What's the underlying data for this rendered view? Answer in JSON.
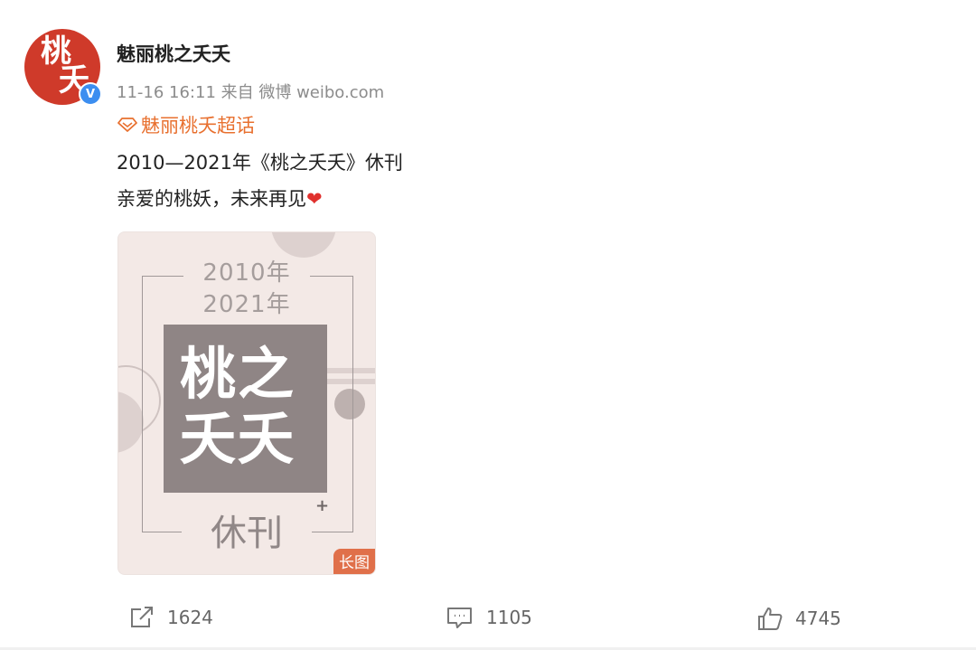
{
  "avatar": {
    "glyph_top": "桃",
    "glyph_bottom": "夭",
    "verified_mark": "V",
    "bg_color": "#cf3a2a",
    "badge_color": "#3c8ef0"
  },
  "post": {
    "username": "魅丽桃之夭夭",
    "meta": "11-16 16:11  来自 微博 weibo.com",
    "topic": "魅丽桃夭超话",
    "topic_icon": "diamond-icon",
    "line1": "2010—2021年《桃之夭夭》休刊",
    "line2": "亲爱的桃妖，未来再见",
    "heart": "❤"
  },
  "image": {
    "year_start": "2010年",
    "year_end": "2021年",
    "title_line1": "桃之",
    "title_line2": "夭夭",
    "subtitle": "休刊",
    "plus": "+",
    "tag": "长图"
  },
  "actions": {
    "repost_count": "1624",
    "comment_count": "1105",
    "like_count": "4745"
  }
}
